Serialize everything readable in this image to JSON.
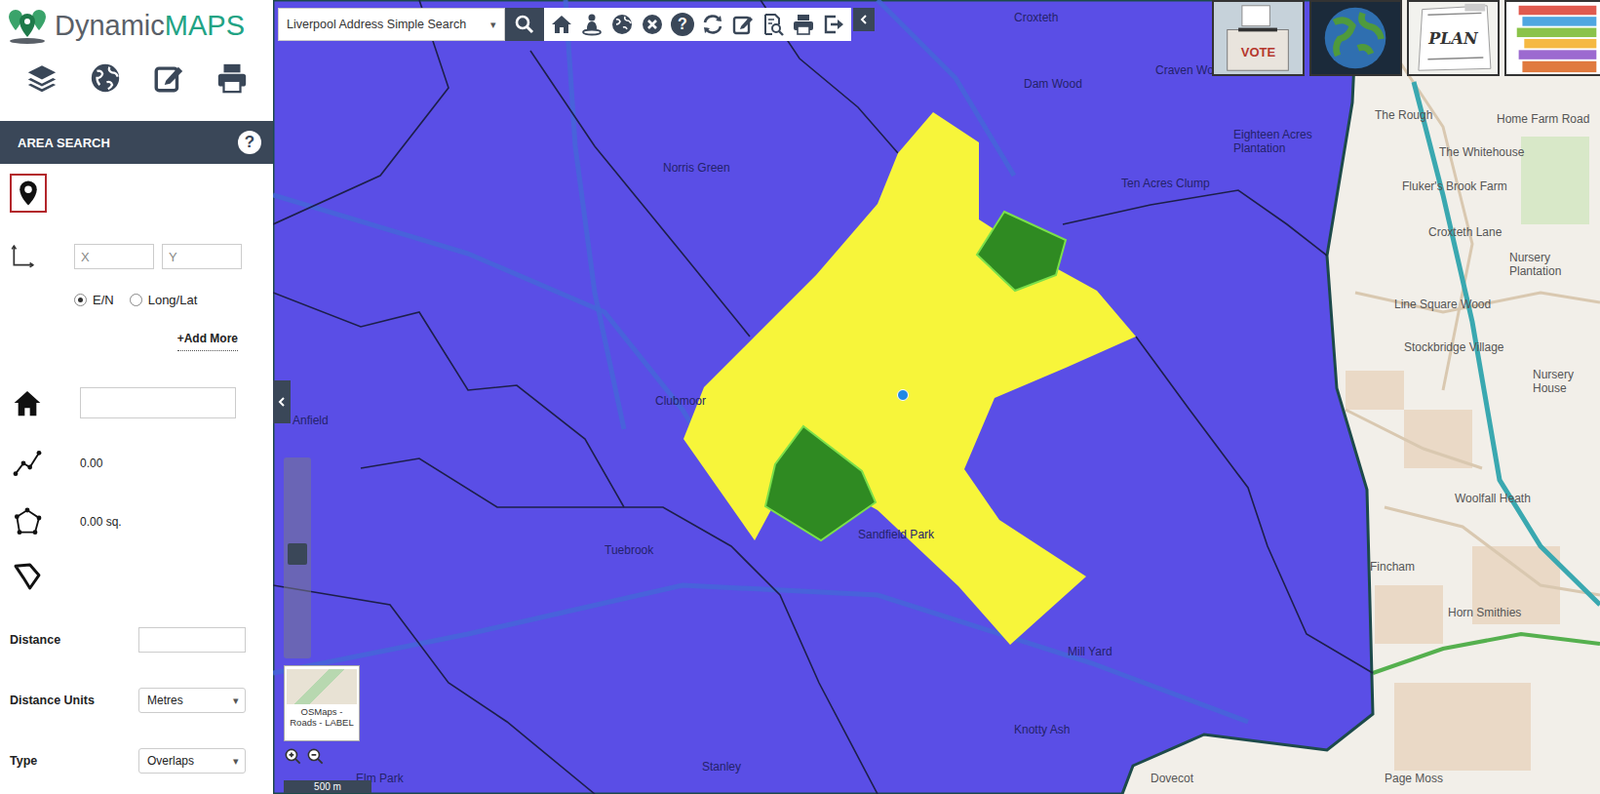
{
  "app": {
    "brand": "Dynamic",
    "brand_accent": "MAPS"
  },
  "toolbar": {
    "search_layer": "Liverpool Address Simple Search",
    "caret": "▾",
    "help": "?"
  },
  "thumbnails": [
    {
      "kind": "vote",
      "caption": "VOTE"
    },
    {
      "kind": "globe"
    },
    {
      "kind": "plan",
      "caption": "PLAN"
    },
    {
      "kind": "books"
    }
  ],
  "sidebar": {
    "title": "AREA SEARCH",
    "help": "?",
    "point_tool_active": true,
    "x_placeholder": "X",
    "y_placeholder": "Y",
    "coord_modes": [
      {
        "label": "E/N",
        "selected": true
      },
      {
        "label": "Long/Lat",
        "selected": false
      }
    ],
    "add_more": "+Add More",
    "address_value": "",
    "length": "0.00",
    "area": "0.00 sq.",
    "fields": [
      {
        "label": "Distance",
        "kind": "input",
        "value": ""
      },
      {
        "label": "Distance Units",
        "kind": "select",
        "value": "Metres"
      },
      {
        "label": "Type",
        "kind": "select",
        "value": "Overlaps"
      }
    ],
    "caret": "▾"
  },
  "map": {
    "areas": [
      {
        "name": "search-area",
        "color": "#f7f53a"
      },
      {
        "name": "result-area",
        "color": "#2f8a22"
      },
      {
        "name": "result-area",
        "color": "#2f8a22"
      }
    ],
    "labels": [
      "Croxteth",
      "Dam Wood",
      "Craven Wood",
      "Norris Green",
      "Ten Acres Clump",
      "Eighteen Acres Plantation",
      "Clubmoor",
      "Anfield",
      "Tuebrook",
      "Sandfield Park",
      "Mill Yard",
      "Knotty Ash",
      "Stanley",
      "Elm Park",
      "Dovecot",
      "The Rough",
      "Home Farm Road",
      "The Whitehouse",
      "Fluker's Brook Farm",
      "Croxteth Lane",
      "Nursery Plantation",
      "Line Square Wood",
      "Stockbridge Village",
      "Nursery House",
      "Woolfall Heath",
      "Fincham",
      "Horn Smithies",
      "Page Moss"
    ],
    "basemap": "OSMaps - Roads - LABEL",
    "scale": "500 m"
  }
}
